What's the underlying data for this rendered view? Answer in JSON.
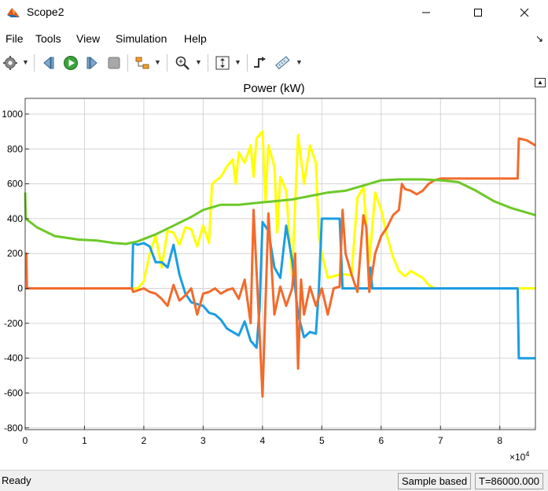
{
  "window": {
    "title": "Scope2",
    "minimize": "—",
    "maximize": "☐",
    "close": "✕"
  },
  "menu": {
    "items": [
      "File",
      "Tools",
      "View",
      "Simulation",
      "Help"
    ],
    "overflow": "↘"
  },
  "toolbar": {
    "icons": [
      "gear-icon",
      "step-back-icon",
      "run-icon",
      "step-forward-icon",
      "stop-icon",
      "highlight-icon",
      "zoom-icon",
      "fit-icon",
      "trigger-icon",
      "measure-icon"
    ]
  },
  "status": {
    "text": "Ready",
    "mode": "Sample based",
    "time": "T=86000.000"
  },
  "chart_data": {
    "type": "line",
    "title": "Power  (kW)",
    "xlabel": "",
    "ylabel": "",
    "x_multiplier": "×10",
    "x_multiplier_exp": "4",
    "xlim": [
      0,
      8.6
    ],
    "ylim": [
      -810,
      1090
    ],
    "xticks": [
      0,
      1,
      2,
      3,
      4,
      5,
      6,
      7,
      8
    ],
    "yticks": [
      1000,
      800,
      600,
      400,
      200,
      0,
      -200,
      -400,
      -600,
      -800
    ],
    "grid": true,
    "series": [
      {
        "color": "#ffff00",
        "values": [
          [
            0,
            0
          ],
          [
            1.8,
            0
          ],
          [
            1.9,
            0
          ],
          [
            2.0,
            40
          ],
          [
            2.1,
            200
          ],
          [
            2.2,
            300
          ],
          [
            2.3,
            120
          ],
          [
            2.4,
            330
          ],
          [
            2.5,
            320
          ],
          [
            2.6,
            250
          ],
          [
            2.7,
            350
          ],
          [
            2.8,
            340
          ],
          [
            2.9,
            240
          ],
          [
            3.0,
            360
          ],
          [
            3.1,
            260
          ],
          [
            3.15,
            600
          ],
          [
            3.3,
            640
          ],
          [
            3.4,
            700
          ],
          [
            3.5,
            740
          ],
          [
            3.55,
            600
          ],
          [
            3.6,
            780
          ],
          [
            3.7,
            720
          ],
          [
            3.8,
            820
          ],
          [
            3.85,
            640
          ],
          [
            3.9,
            860
          ],
          [
            4.0,
            900
          ],
          [
            4.05,
            500
          ],
          [
            4.1,
            820
          ],
          [
            4.2,
            700
          ],
          [
            4.25,
            320
          ],
          [
            4.3,
            640
          ],
          [
            4.4,
            560
          ],
          [
            4.5,
            70
          ],
          [
            4.6,
            880
          ],
          [
            4.7,
            600
          ],
          [
            4.8,
            820
          ],
          [
            4.9,
            720
          ],
          [
            4.95,
            300
          ],
          [
            5.0,
            200
          ],
          [
            5.1,
            60
          ],
          [
            5.2,
            70
          ],
          [
            5.3,
            80
          ],
          [
            5.4,
            80
          ],
          [
            5.5,
            75
          ],
          [
            5.6,
            520
          ],
          [
            5.7,
            580
          ],
          [
            5.8,
            150
          ],
          [
            5.9,
            550
          ],
          [
            6.0,
            450
          ],
          [
            6.1,
            300
          ],
          [
            6.2,
            180
          ],
          [
            6.3,
            100
          ],
          [
            6.4,
            70
          ],
          [
            6.5,
            100
          ],
          [
            6.6,
            80
          ],
          [
            6.7,
            60
          ],
          [
            6.8,
            20
          ],
          [
            6.9,
            0
          ],
          [
            8.6,
            0
          ]
        ]
      },
      {
        "color": "#1b9de2",
        "values": [
          [
            0,
            0
          ],
          [
            1.8,
            0
          ],
          [
            1.82,
            260
          ],
          [
            1.9,
            250
          ],
          [
            2.0,
            260
          ],
          [
            2.1,
            240
          ],
          [
            2.2,
            150
          ],
          [
            2.3,
            150
          ],
          [
            2.4,
            120
          ],
          [
            2.5,
            250
          ],
          [
            2.6,
            80
          ],
          [
            2.7,
            -30
          ],
          [
            2.8,
            -80
          ],
          [
            2.9,
            -90
          ],
          [
            3.0,
            -100
          ],
          [
            3.1,
            -140
          ],
          [
            3.2,
            -150
          ],
          [
            3.3,
            -180
          ],
          [
            3.4,
            -230
          ],
          [
            3.5,
            -250
          ],
          [
            3.6,
            -270
          ],
          [
            3.7,
            -190
          ],
          [
            3.8,
            -300
          ],
          [
            3.9,
            -340
          ],
          [
            3.95,
            -120
          ],
          [
            4.0,
            380
          ],
          [
            4.1,
            330
          ],
          [
            4.2,
            120
          ],
          [
            4.3,
            60
          ],
          [
            4.4,
            360
          ],
          [
            4.5,
            160
          ],
          [
            4.6,
            -150
          ],
          [
            4.7,
            -280
          ],
          [
            4.8,
            -250
          ],
          [
            4.9,
            -260
          ],
          [
            4.95,
            0
          ],
          [
            5.0,
            400
          ],
          [
            5.3,
            400
          ],
          [
            5.35,
            0
          ],
          [
            5.8,
            0
          ],
          [
            5.82,
            120
          ],
          [
            5.85,
            0
          ],
          [
            8.3,
            0
          ],
          [
            8.32,
            -400
          ],
          [
            8.6,
            -400
          ]
        ]
      },
      {
        "color": "#f26b2c",
        "values": [
          [
            0,
            200
          ],
          [
            0.02,
            200
          ],
          [
            0.03,
            0
          ],
          [
            1.8,
            0
          ],
          [
            1.82,
            -20
          ],
          [
            2.0,
            0
          ],
          [
            2.1,
            -20
          ],
          [
            2.2,
            -30
          ],
          [
            2.3,
            -60
          ],
          [
            2.4,
            -100
          ],
          [
            2.5,
            20
          ],
          [
            2.6,
            -70
          ],
          [
            2.7,
            -40
          ],
          [
            2.8,
            0
          ],
          [
            2.9,
            -150
          ],
          [
            3.0,
            -30
          ],
          [
            3.1,
            -20
          ],
          [
            3.2,
            0
          ],
          [
            3.3,
            -30
          ],
          [
            3.4,
            -10
          ],
          [
            3.5,
            0
          ],
          [
            3.6,
            -60
          ],
          [
            3.7,
            50
          ],
          [
            3.8,
            -200
          ],
          [
            3.85,
            450
          ],
          [
            3.9,
            100
          ],
          [
            3.95,
            -250
          ],
          [
            4.0,
            -620
          ],
          [
            4.05,
            -100
          ],
          [
            4.1,
            430
          ],
          [
            4.2,
            -150
          ],
          [
            4.3,
            10
          ],
          [
            4.4,
            -100
          ],
          [
            4.5,
            0
          ],
          [
            4.55,
            200
          ],
          [
            4.6,
            -460
          ],
          [
            4.65,
            50
          ],
          [
            4.7,
            -150
          ],
          [
            4.8,
            10
          ],
          [
            4.9,
            -100
          ],
          [
            5.0,
            0
          ],
          [
            5.1,
            -150
          ],
          [
            5.2,
            0
          ],
          [
            5.3,
            10
          ],
          [
            5.35,
            450
          ],
          [
            5.4,
            200
          ],
          [
            5.5,
            80
          ],
          [
            5.6,
            -20
          ],
          [
            5.7,
            420
          ],
          [
            5.75,
            350
          ],
          [
            5.8,
            -20
          ],
          [
            5.9,
            200
          ],
          [
            6.0,
            300
          ],
          [
            6.1,
            350
          ],
          [
            6.2,
            420
          ],
          [
            6.3,
            450
          ],
          [
            6.35,
            600
          ],
          [
            6.4,
            570
          ],
          [
            6.5,
            560
          ],
          [
            6.6,
            540
          ],
          [
            6.7,
            560
          ],
          [
            6.8,
            600
          ],
          [
            6.9,
            620
          ],
          [
            7.0,
            630
          ],
          [
            8.3,
            630
          ],
          [
            8.32,
            860
          ],
          [
            8.45,
            850
          ],
          [
            8.6,
            820
          ]
        ]
      },
      {
        "color": "#6cc927",
        "values": [
          [
            0,
            550
          ],
          [
            0.01,
            400
          ],
          [
            0.2,
            350
          ],
          [
            0.5,
            300
          ],
          [
            0.9,
            280
          ],
          [
            1.2,
            275
          ],
          [
            1.5,
            260
          ],
          [
            1.7,
            255
          ],
          [
            1.9,
            270
          ],
          [
            2.2,
            310
          ],
          [
            2.5,
            360
          ],
          [
            2.8,
            410
          ],
          [
            3.0,
            450
          ],
          [
            3.3,
            480
          ],
          [
            3.6,
            480
          ],
          [
            3.9,
            490
          ],
          [
            4.2,
            500
          ],
          [
            4.5,
            510
          ],
          [
            4.8,
            530
          ],
          [
            5.1,
            550
          ],
          [
            5.4,
            560
          ],
          [
            5.7,
            590
          ],
          [
            6.0,
            620
          ],
          [
            6.3,
            625
          ],
          [
            6.7,
            625
          ],
          [
            7.0,
            620
          ],
          [
            7.3,
            610
          ],
          [
            7.6,
            560
          ],
          [
            7.9,
            500
          ],
          [
            8.2,
            460
          ],
          [
            8.5,
            430
          ],
          [
            8.6,
            420
          ]
        ]
      }
    ]
  }
}
